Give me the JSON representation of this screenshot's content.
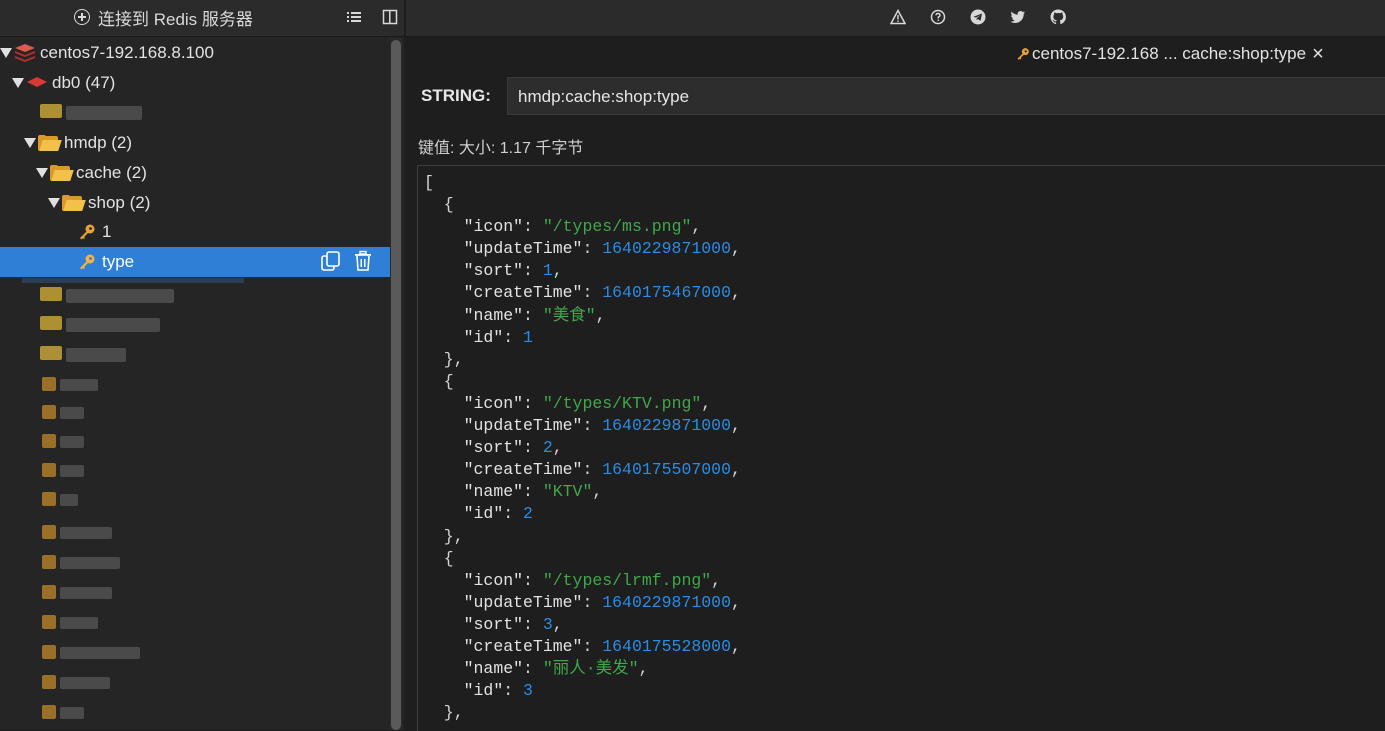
{
  "sidebar": {
    "connect_label": "连接到 Redis 服务器",
    "connection_name": "centos7-192.168.8.100",
    "db_label": "db0",
    "db_count": "(47)",
    "hmdp_label": "hmdp",
    "hmdp_count": "(2)",
    "cache_label": "cache",
    "cache_count": "(2)",
    "shop_label": "shop",
    "shop_count": "(2)",
    "key_1_label": "1",
    "key_type_label": "type"
  },
  "header_icons": [
    "warning-icon",
    "help-icon",
    "telegram-icon",
    "twitter-icon",
    "github-icon"
  ],
  "tab": {
    "label": "centos7-192.168 ... cache:shop:type",
    "close": "×"
  },
  "key_view": {
    "type_label": "STRING:",
    "key_name": "hmdp:cache:shop:type",
    "size_label": "键值: 大小: 1.17 千字节"
  },
  "colors": {
    "accent": "#2f7fd6",
    "string": "#3fa84a",
    "number": "#2a8ce6",
    "folder": "#f3c04a",
    "redis": "#d83b35"
  },
  "json_value": {
    "open_bracket": "[",
    "items": [
      {
        "icon": "\"/types/ms.png\"",
        "updateTime": "1640229871000",
        "sort": "1",
        "createTime": "1640175467000",
        "name": "\"美食\"",
        "id": "1"
      },
      {
        "icon": "\"/types/KTV.png\"",
        "updateTime": "1640229871000",
        "sort": "2",
        "createTime": "1640175507000",
        "name": "\"KTV\"",
        "id": "2"
      },
      {
        "icon": "\"/types/lrmf.png\"",
        "updateTime": "1640229871000",
        "sort": "3",
        "createTime": "1640175528000",
        "name": "\"丽人·美发\"",
        "id": "3"
      }
    ]
  }
}
